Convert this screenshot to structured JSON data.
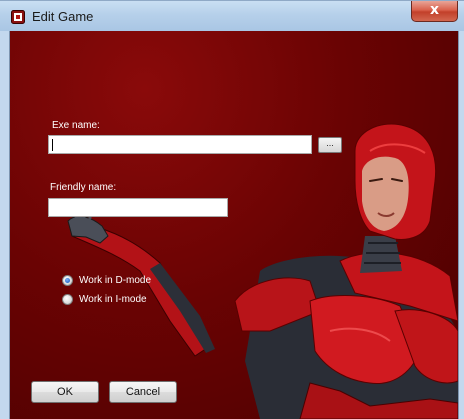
{
  "window": {
    "title": "Edit Game",
    "close_glyph": "x",
    "icon": "app-icon"
  },
  "form": {
    "exe_label": "Exe name:",
    "exe_value": "",
    "browse_label": "...",
    "friendly_label": "Friendly name:",
    "friendly_value": "",
    "mode_options": [
      {
        "label": "Work in D-mode",
        "checked": true
      },
      {
        "label": "Work in I-mode",
        "checked": false
      }
    ]
  },
  "buttons": {
    "ok_label": "OK",
    "cancel_label": "Cancel"
  },
  "colors": {
    "background": "#6a0303",
    "armor_red": "#c4141a",
    "suit_dark": "#2a2d36",
    "skin": "#d99c86"
  }
}
